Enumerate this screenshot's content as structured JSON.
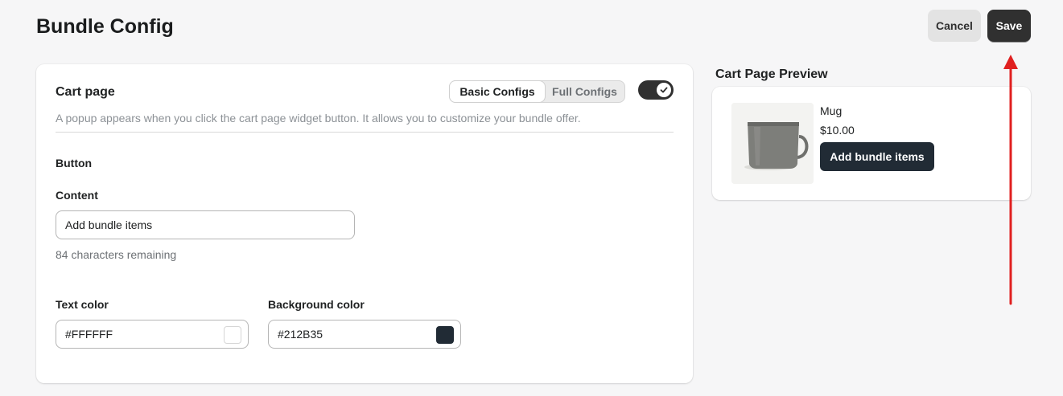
{
  "header": {
    "title": "Bundle Config",
    "cancel_label": "Cancel",
    "save_label": "Save"
  },
  "config_card": {
    "title": "Cart page",
    "description": "A popup appears when you click the cart page widget button. It allows you to customize your bundle offer.",
    "tabs": [
      {
        "label": "Basic Configs",
        "active": true
      },
      {
        "label": "Full Configs",
        "active": false
      }
    ],
    "toggle": {
      "on": true
    },
    "section_label": "Button",
    "content": {
      "label": "Content",
      "value": "Add bundle items",
      "helper": "84 characters remaining"
    },
    "text_color": {
      "label": "Text color",
      "value": "#FFFFFF",
      "swatch": "#FFFFFF"
    },
    "background_color": {
      "label": "Background color",
      "value": "#212B35",
      "swatch": "#212B35"
    }
  },
  "preview": {
    "title": "Cart Page Preview",
    "product": {
      "name": "Mug",
      "price": "$10.00",
      "image_icon": "mug-image"
    },
    "button_label": "Add bundle items"
  },
  "annotation": {
    "arrow_color": "#E02020",
    "arrow_target": "save-button"
  }
}
